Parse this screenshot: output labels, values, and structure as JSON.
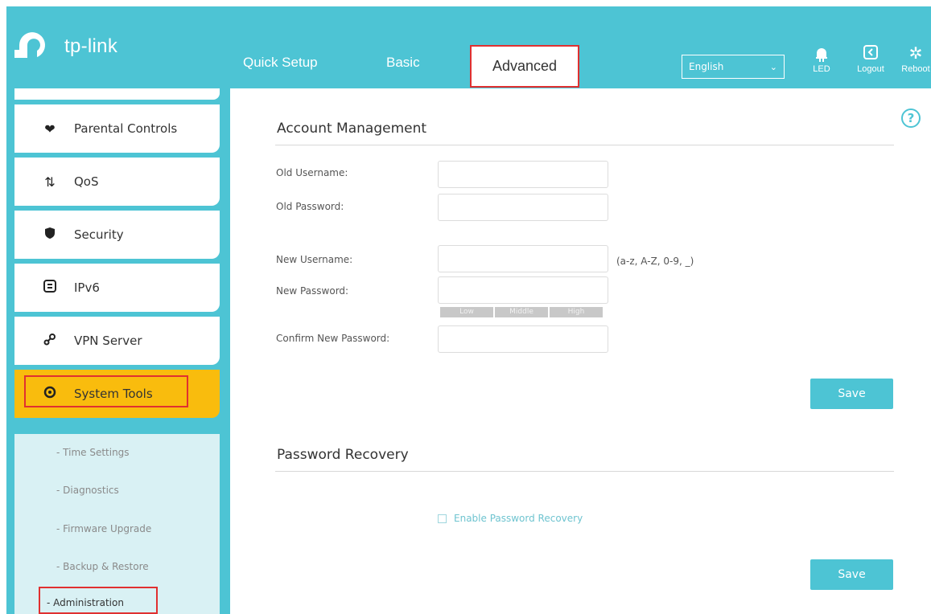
{
  "header": {
    "brand": "tp-link",
    "tabs": [
      {
        "label": "Quick Setup"
      },
      {
        "label": "Basic"
      },
      {
        "label": "Advanced"
      }
    ],
    "active_tab": "Advanced",
    "language": "English",
    "buttons": [
      {
        "label": "LED",
        "icon": "led-icon"
      },
      {
        "label": "Logout",
        "icon": "logout-icon"
      },
      {
        "label": "Reboot",
        "icon": "reboot-icon"
      }
    ],
    "accent_color": "#4dc4d4"
  },
  "sidebar": {
    "items": [
      {
        "label": "Parental Controls",
        "icon": "heart-icon"
      },
      {
        "label": "QoS",
        "icon": "arrows-updown-icon"
      },
      {
        "label": "Security",
        "icon": "shield-icon"
      },
      {
        "label": "IPv6",
        "icon": "ipv6-icon"
      },
      {
        "label": "VPN Server",
        "icon": "vpn-key-icon"
      },
      {
        "label": "System Tools",
        "icon": "gear-icon"
      }
    ],
    "active_item": "System Tools",
    "active_color": "#f9bc0d",
    "submenu": [
      {
        "label": "- Time Settings"
      },
      {
        "label": "- Diagnostics"
      },
      {
        "label": "- Firmware Upgrade"
      },
      {
        "label": "- Backup & Restore"
      },
      {
        "label": "- Administration"
      }
    ],
    "active_subitem": "- Administration"
  },
  "account": {
    "title": "Account Management",
    "old_username_label": "Old Username:",
    "old_password_label": "Old Password:",
    "new_username_label": "New Username:",
    "new_username_hint": "(a-z, A-Z, 0-9, _)",
    "new_password_label": "New Password:",
    "strength": [
      "Low",
      "Middle",
      "High"
    ],
    "confirm_label": "Confirm New Password:",
    "save_label": "Save"
  },
  "recovery": {
    "title": "Password Recovery",
    "checkbox_label": "Enable Password Recovery",
    "checked": false,
    "save_label": "Save"
  },
  "help": {
    "symbol": "?"
  }
}
